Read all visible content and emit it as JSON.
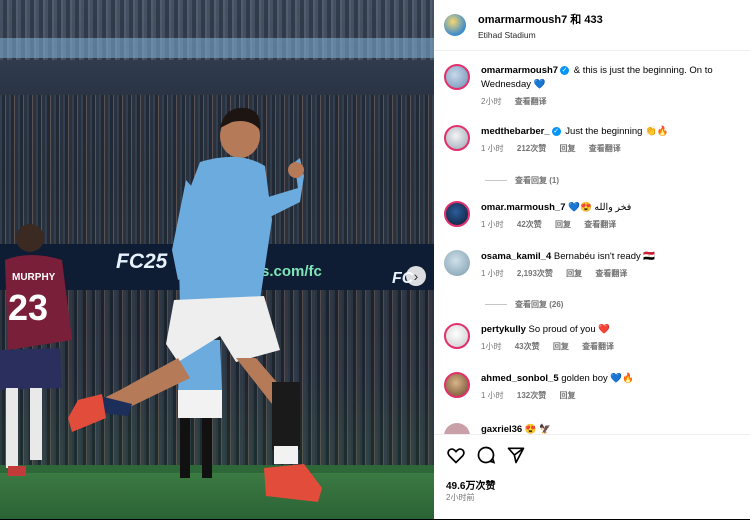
{
  "photo": {
    "ad_fc25": "FC25",
    "ad_web": "ts.com/fc",
    "ad_fc25_2": "FC",
    "player_left_name": "MURPHY",
    "player_left_number": "23",
    "next_arrow": "›"
  },
  "header": {
    "title": "omarmarmoush7 和 433",
    "location": "Etihad Stadium"
  },
  "comments": [
    {
      "user": "omarmarmoush7",
      "verified": true,
      "text": "& this is just the beginning. On to Wednesday 💙",
      "time": "2小时",
      "likes": "",
      "reply": "",
      "translate": "查看翻译"
    },
    {
      "user": "medthebarber_",
      "verified": true,
      "text": "Just the beginning 👏🔥",
      "time": "1 小时",
      "likes": "212次赞",
      "reply": "回复",
      "translate": "查看翻译",
      "view_replies": "查看回复 (1)"
    },
    {
      "user": "omar.marmoush_7",
      "verified": false,
      "text": "💙😍 فخر والله",
      "time": "1 小时",
      "likes": "42次赞",
      "reply": "回复",
      "translate": "查看翻译"
    },
    {
      "user": "osama_kamil_4",
      "verified": false,
      "text": "Bernabéu isn't ready 🇪🇬",
      "time": "1 小时",
      "likes": "2,193次赞",
      "reply": "回复",
      "translate": "查看翻译",
      "view_replies": "查看回复 (26)"
    },
    {
      "user": "pertykully",
      "verified": false,
      "text": "So proud of you ❤️",
      "time": "1小时",
      "likes": "43次赞",
      "reply": "回复",
      "translate": "查看翻译"
    },
    {
      "user": "ahmed_sonbol_5",
      "verified": false,
      "text": "golden boy 💙🔥",
      "time": "1 小时",
      "likes": "132次赞",
      "reply": "回复",
      "translate": ""
    },
    {
      "user": "gaxriel36",
      "verified": false,
      "text": "😍 🦅",
      "time": "",
      "likes": "",
      "reply": "",
      "translate": ""
    }
  ],
  "actions": {
    "likes": "49.6万次赞",
    "posted": "2小时前"
  },
  "colors": {
    "verified": "#0095f6",
    "story_ring": "#e1306c",
    "city_blue": "#6cabdd"
  }
}
